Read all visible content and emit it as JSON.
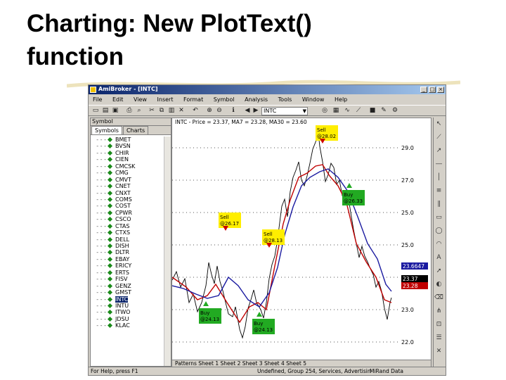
{
  "slide": {
    "title_line1": "Charting: New PlotText()",
    "title_line2": "function"
  },
  "window": {
    "title": "AmiBroker - [INTC]",
    "min": "_",
    "max": "□",
    "close": "×"
  },
  "menu": [
    "File",
    "Edit",
    "View",
    "Insert",
    "Format",
    "Symbol",
    "Analysis",
    "Tools",
    "Window",
    "Help"
  ],
  "toolbar": {
    "symbol": "INTC"
  },
  "sidebar": {
    "header": "Symbol",
    "tabs": [
      "Symbols",
      "Charts"
    ],
    "symbols": [
      "BMET",
      "BVSN",
      "CHIR",
      "CIEN",
      "CMCSK",
      "CMG",
      "CMVT",
      "CNET",
      "CNXT",
      "COMS",
      "COST",
      "CPWR",
      "CSCO",
      "CTAS",
      "CTXS",
      "DELL",
      "DISH",
      "DLTR",
      "EBAY",
      "ERICY",
      "ERTS",
      "FISV",
      "GENZ",
      "GMST",
      "INTC",
      "INTU",
      "ITWO",
      "JDSU",
      "KLAC"
    ],
    "selected": "INTC"
  },
  "chart": {
    "header": "INTC - Price = 23.37, MA7 = 23.28, MA30 = 23.60",
    "y_ticks": [
      "29.0",
      "27.0",
      "25.0",
      "25.0",
      "24.0",
      "23.0",
      "22.0"
    ],
    "signals": [
      {
        "type": "buy",
        "line1": "Buy",
        "line2": "@24.13"
      },
      {
        "type": "sell",
        "line1": "Sell",
        "line2": "@28.13"
      },
      {
        "type": "buy",
        "line1": "Buy",
        "line2": "@26.33"
      },
      {
        "type": "sell",
        "line1": "Sell",
        "line2": "@28.02"
      },
      {
        "type": "buy",
        "line1": "Buy",
        "line2": "@24.13"
      },
      {
        "type": "sell",
        "line1": "Sell",
        "line2": "@26.17"
      }
    ],
    "price_labels": [
      {
        "text": "23.6647",
        "bg": "#1a1aa0",
        "fg": "#ffffff"
      },
      {
        "text": "23.37",
        "bg": "#000000",
        "fg": "#ffffff"
      },
      {
        "text": "23.28",
        "bg": "#c00000",
        "fg": "#ffffff"
      }
    ],
    "bottom_tabs": "Patterns  Sheet 1  Sheet 2  Sheet 3  Sheet 4  Sheet 5"
  },
  "status": {
    "left": "For Help, press F1",
    "mid": "Undefined, Group 254, Services, Advertisin",
    "right": "MiRand Data"
  },
  "colors": {
    "price": "#000000",
    "ma_fast": "#c00000",
    "ma_slow": "#1a1aa0",
    "buy_bg": "#22aa22",
    "sell_bg": "#ffee00",
    "arrow_up": "#22aa22",
    "arrow_down": "#cc0000"
  }
}
